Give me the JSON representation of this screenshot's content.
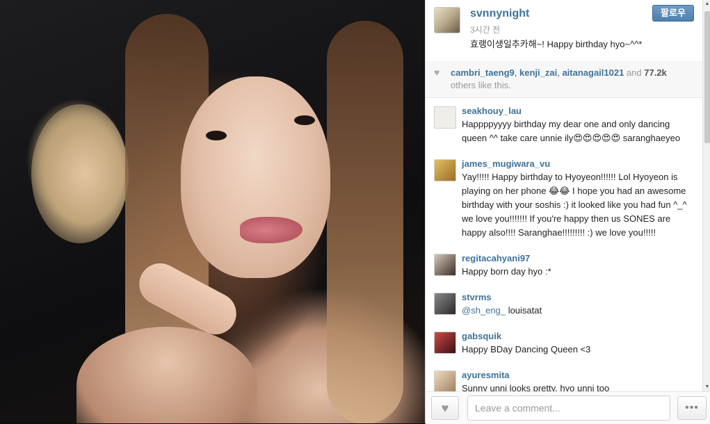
{
  "post": {
    "username": "svnnynight",
    "time_ago": "3시간 전",
    "caption": "효랭이생일추카해~! Happy birthday hyo~^^*",
    "follow_label": "팔로우"
  },
  "likes": {
    "users": [
      "cambri_taeng9",
      "kenji_zai",
      "aitanagail1021"
    ],
    "sep1": ", ",
    "sep2": ", ",
    "and": " and ",
    "count": "77.2k",
    "others": "others like this."
  },
  "comments": [
    {
      "user": "seakhouy_lau",
      "text": "Happppyyyy birthday my dear one and only dancing queen ^^ take care unnie ily😍😍😍😍😍 saranghaeyeo",
      "avatar_color": "#f0eee9"
    },
    {
      "user": "james_mugiwara_vu",
      "text": "Yay!!!!! Happy birthday to Hyoyeon!!!!!! Lol Hyoyeon is playing on her phone 😂😂 I hope you had an awesome birthday with your soshis :) it looked like you had fun ^_^ we love you!!!!!!! If you're happy then us SONES are happy also!!!! Saranghae!!!!!!!!! :) we love you!!!!!",
      "avatar_color": "#c9a13b"
    },
    {
      "user": "regitacahyani97",
      "text": "Happy born day hyo :*",
      "avatar_color": "#6b5a4e"
    },
    {
      "user": "stvrms",
      "mention": "@sh_eng_",
      "text": " louisatat",
      "avatar_color": "#4a4a4a"
    },
    {
      "user": "gabsquik",
      "text": "Happy BDay Dancing Queen <3",
      "avatar_color": "#7a2b2b"
    },
    {
      "user": "ayuresmita",
      "text": "Sunny unni looks pretty. hyo unni too",
      "avatar_color": "#d8c1a0"
    }
  ],
  "footer": {
    "comment_placeholder": "Leave a comment...",
    "heart_icon": "♥",
    "more_icon": "•••"
  }
}
